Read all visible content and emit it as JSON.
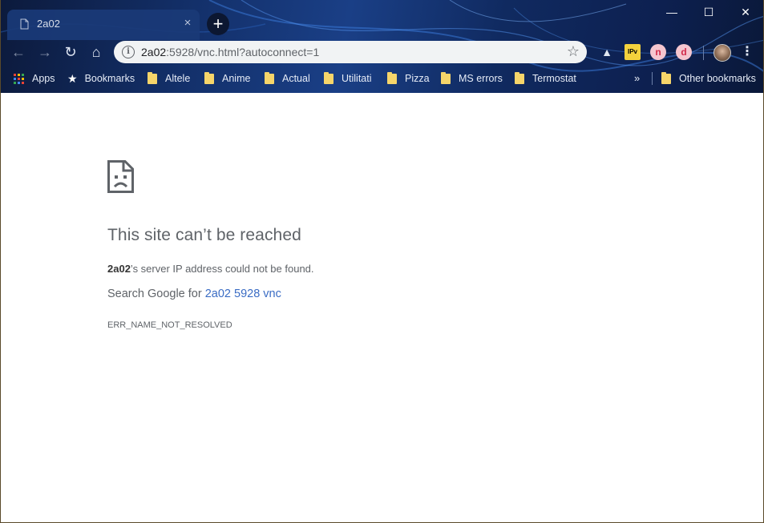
{
  "tab": {
    "title": "2a02",
    "close_label": "×",
    "new_tab_label": "+"
  },
  "window_controls": {
    "minimize": "—",
    "maximize": "☐",
    "close": "✕"
  },
  "toolbar": {
    "back": "←",
    "forward": "→",
    "reload": "↻",
    "home": "⌂",
    "url_host": "2a02",
    "url_rest": ":5928/vnc.html?autoconnect=1",
    "bookmark_star": "☆",
    "menu": "⋮",
    "extensions": [
      {
        "name": "drive-icon",
        "label": "▲"
      },
      {
        "name": "ipv6-icon",
        "label": "IPv"
      },
      {
        "name": "n-extension-icon",
        "label": "n"
      },
      {
        "name": "d-extension-icon",
        "label": "d"
      }
    ]
  },
  "bookmarks": {
    "apps_label": "Apps",
    "bookmarks_label": "Bookmarks",
    "folders": [
      "Altele",
      "Anime",
      "Actual",
      "Utilitati",
      "Pizza",
      "MS errors",
      "Termostat"
    ],
    "overflow": "»",
    "other": "Other bookmarks",
    "apps_colors": [
      "#ea4335",
      "#fbbc05",
      "#34a853",
      "#4285f4",
      "#ea4335",
      "#fbbc05",
      "#34a853",
      "#4285f4",
      "#ea4335"
    ]
  },
  "error_page": {
    "heading": "This site can’t be reached",
    "host": "2a02",
    "message_rest": "’s server IP address could not be found.",
    "search_prefix": "Search Google for ",
    "search_link": "2a02 5928 vnc",
    "error_code": "ERR_NAME_NOT_RESOLVED"
  },
  "colors": {
    "frame": "#13306a",
    "omnibox": "#f1f3f4",
    "link": "#3a6cc4",
    "text_secondary": "#5f6368"
  }
}
